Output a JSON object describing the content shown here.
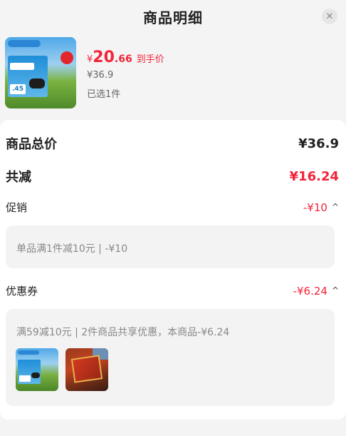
{
  "header": {
    "title": "商品明细",
    "close_icon": "close-icon"
  },
  "product": {
    "image_icon": "milk-product-thumbnail",
    "thumb_badge_text": ".45",
    "price_currency": "¥",
    "price_integer": "20",
    "price_decimal": ".66",
    "price_tag": "到手价",
    "original_price": "¥36.9",
    "selected_text": "已选1件"
  },
  "summary": {
    "total_label": "商品总价",
    "total_value": "¥36.9",
    "reduce_label": "共减",
    "reduce_value": "¥16.24",
    "promo_label": "促销",
    "promo_value": "-¥10",
    "promo_chevron": "^",
    "promo_detail": "单品满1件减10元 | -¥10",
    "coupon_label": "优惠券",
    "coupon_value": "-¥6.24",
    "coupon_chevron": "^",
    "coupon_detail": "满59减10元 | 2件商品共享优惠，本商品-¥6.24",
    "coupon_items": [
      "milk-product-thumbnail",
      "gift-box-product-thumbnail"
    ]
  },
  "colors": {
    "accent_red": "#f2243a",
    "background": "#f4f4f4",
    "card": "#ffffff",
    "subbox": "#f3f3f3"
  }
}
